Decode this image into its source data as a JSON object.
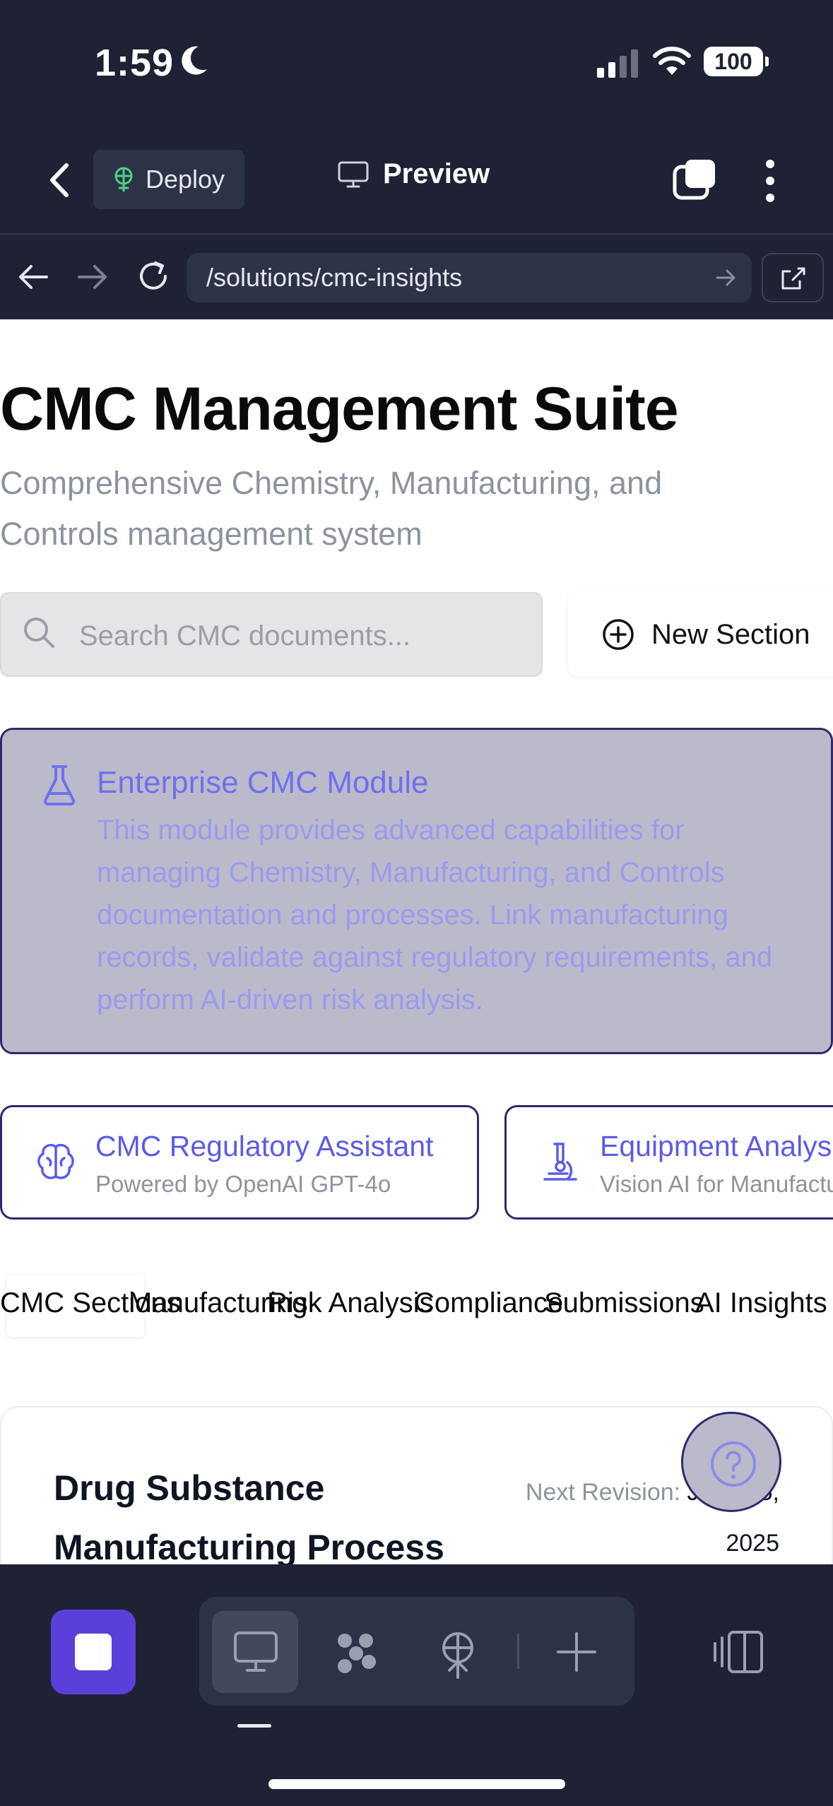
{
  "status_bar": {
    "time": "1:59",
    "battery": "100"
  },
  "header": {
    "deploy_label": "Deploy",
    "preview_label": "Preview"
  },
  "browser": {
    "url": "/solutions/cmc-insights"
  },
  "page": {
    "title": "CMC Management Suite",
    "subtitle": "Comprehensive Chemistry, Manufacturing, and Controls management system",
    "search_placeholder": "Search CMC documents...",
    "new_section_label": "New Section"
  },
  "enterprise_module": {
    "title": "Enterprise CMC Module",
    "body": "This module provides advanced capabilities for managing Chemistry, Manufacturing, and Controls documentation and processes. Link manufacturing records, validate against regulatory requirements, and perform AI-driven risk analysis."
  },
  "features": [
    {
      "title": "CMC Regulatory Assistant",
      "subtitle": "Powered by OpenAI GPT-4o"
    },
    {
      "title": "Equipment Analysis",
      "subtitle": "Vision AI for Manufacturing"
    }
  ],
  "tabs": [
    "CMC Sections",
    "Manufacturing",
    "Risk Analysis",
    "Compliance",
    "Submissions",
    "AI Insights"
  ],
  "card": {
    "title": "Drug Substance Manufacturing Process",
    "revision_label": "Next Revision:",
    "revision_date": "June 15, 2025"
  },
  "colors": {
    "accent": "#5b3fdb",
    "header_bg": "#1e2234",
    "module_bg": "#bbbaca",
    "module_border": "#2e2a6e",
    "link": "#5b5be8"
  }
}
